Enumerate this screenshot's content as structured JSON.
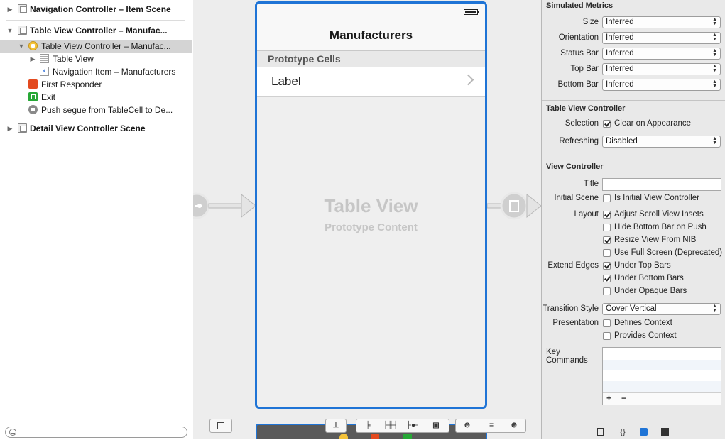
{
  "outline": {
    "rows": [
      {
        "label": "Navigation Controller – Item Scene"
      },
      {
        "label": "Table View Controller – Manufac..."
      },
      {
        "label": "Table View Controller – Manufac..."
      },
      {
        "label": "Table View"
      },
      {
        "label": "Navigation Item – Manufacturers"
      },
      {
        "label": "First Responder"
      },
      {
        "label": "Exit"
      },
      {
        "label": "Push segue from TableCell to De..."
      },
      {
        "label": "Detail View Controller Scene"
      }
    ]
  },
  "canvas": {
    "nav_title": "Manufacturers",
    "section_header": "Prototype Cells",
    "cell_label": "Label",
    "placeholder_title": "Table View",
    "placeholder_subtitle": "Prototype Content"
  },
  "inspector": {
    "simulated_metrics": {
      "title": "Simulated Metrics",
      "size": {
        "label": "Size",
        "value": "Inferred"
      },
      "orientation": {
        "label": "Orientation",
        "value": "Inferred"
      },
      "status_bar": {
        "label": "Status Bar",
        "value": "Inferred"
      },
      "top_bar": {
        "label": "Top Bar",
        "value": "Inferred"
      },
      "bottom_bar": {
        "label": "Bottom Bar",
        "value": "Inferred"
      }
    },
    "table_view_controller": {
      "title": "Table View Controller",
      "selection_label": "Selection",
      "clear_on_appearance": {
        "label": "Clear on Appearance",
        "checked": true
      },
      "refreshing": {
        "label": "Refreshing",
        "value": "Disabled"
      }
    },
    "view_controller": {
      "title": "View Controller",
      "title_field_label": "Title",
      "title_value": "",
      "initial_scene_label": "Initial Scene",
      "is_initial": {
        "label": "Is Initial View Controller",
        "checked": false
      },
      "layout_label": "Layout",
      "adjust_insets": {
        "label": "Adjust Scroll View Insets",
        "checked": true
      },
      "hide_bottom_bar": {
        "label": "Hide Bottom Bar on Push",
        "checked": false
      },
      "resize_from_nib": {
        "label": "Resize View From NIB",
        "checked": true
      },
      "full_screen": {
        "label": "Use Full Screen (Deprecated)",
        "checked": false
      },
      "extend_edges_label": "Extend Edges",
      "under_top": {
        "label": "Under Top Bars",
        "checked": true
      },
      "under_bottom": {
        "label": "Under Bottom Bars",
        "checked": true
      },
      "under_opaque": {
        "label": "Under Opaque Bars",
        "checked": false
      },
      "transition_style": {
        "label": "Transition Style",
        "value": "Cover Vertical"
      },
      "presentation_label": "Presentation",
      "defines_context": {
        "label": "Defines Context",
        "checked": false
      },
      "provides_context": {
        "label": "Provides Context",
        "checked": false
      },
      "key_commands_label": "Key Commands",
      "add_symbol": "+",
      "remove_symbol": "−"
    }
  },
  "colors": {
    "selection_blue": "#1f74d6",
    "outline_selection": "#d4d4d4",
    "inspector_bg": "#e9e9e9",
    "canvas_bg": "#ededed"
  },
  "icons": {
    "outline": [
      "scene-icon",
      "view-controller-icon",
      "table-view-icon",
      "nav-item-icon",
      "first-responder-icon",
      "exit-icon",
      "segue-icon"
    ],
    "canvas_toolbar": [
      "document-outline-icon",
      "fixed-size-icon",
      "align-icon",
      "pin-icon",
      "resolve-icon",
      "resizing-icon",
      "zoom-out-icon",
      "zoom-fit-icon",
      "zoom-in-icon"
    ],
    "inspector_tabs": [
      "file-icon",
      "code-icon",
      "object-icon",
      "library-icon"
    ]
  }
}
